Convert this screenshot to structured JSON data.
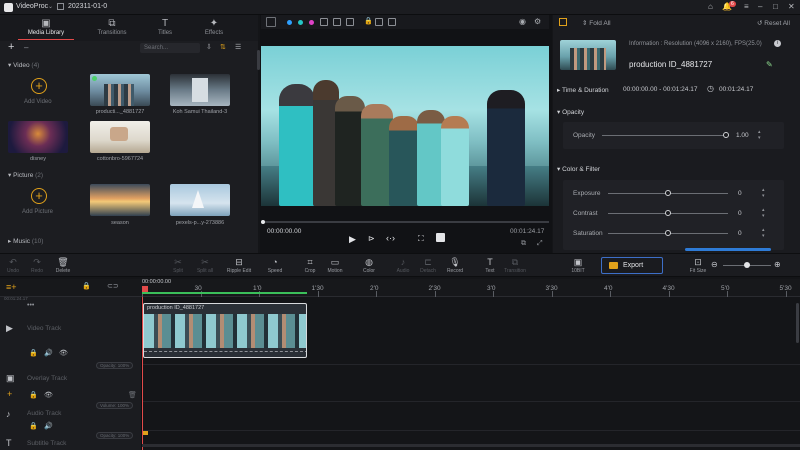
{
  "app": {
    "name": "VideoProc",
    "project": "202311-01-0",
    "notification_count": "6"
  },
  "library": {
    "tabs": [
      {
        "label": "Media Library",
        "icon": "film-icon"
      },
      {
        "label": "Transitions",
        "icon": "transition-icon"
      },
      {
        "label": "Titles",
        "icon": "title-icon"
      },
      {
        "label": "Effects",
        "icon": "effects-icon"
      }
    ],
    "search_placeholder": "Search...",
    "video_section": {
      "title": "Video",
      "count": "(4)"
    },
    "video_items": [
      {
        "label": "Add Video"
      },
      {
        "label": "producti..._4881727"
      },
      {
        "label": "Koh Samui Thailand-3"
      },
      {
        "label": "disney"
      },
      {
        "label": "cottonbro-5967724"
      }
    ],
    "picture_section": {
      "title": "Picture",
      "count": "(2)"
    },
    "picture_items": [
      {
        "label": "Add Picture"
      },
      {
        "label": "season"
      },
      {
        "label": "pexels-p...y-273886"
      }
    ],
    "music_section": {
      "title": "Music",
      "count": "(10)"
    }
  },
  "player": {
    "current_time": "00:00:00.00",
    "total_time": "00:01:24.17",
    "progress": 0.0
  },
  "inspector": {
    "fold_all": "Fold All",
    "reset_all": "Reset All",
    "info": "Information : Resolution (4096 x 2160), FPS(25.0)",
    "clip_name": "production ID_4881727",
    "time_section": "Time & Duration",
    "start": "00:00:00.00 - 00:01:24.17",
    "duration": "00:01:24.17",
    "opacity_section": "Opacity",
    "opacity_label": "Opacity",
    "opacity_value": "1.00",
    "opacity_level": 1.0,
    "color_section": "Color & Filter",
    "exposure_label": "Exposure",
    "exposure_value": "0",
    "contrast_label": "Contrast",
    "contrast_value": "0",
    "saturation_label": "Saturation",
    "saturation_value": "0"
  },
  "toolbar": {
    "undo": "Undo",
    "redo": "Redo",
    "delete": "Delete",
    "split": "Split",
    "split_all": "Split all",
    "ripple_edit": "Ripple Edit",
    "speed": "Speed",
    "crop": "Crop",
    "motion": "Motion",
    "color": "Color",
    "audio": "Audio",
    "detach": "Detach",
    "record": "Record",
    "text": "Text",
    "transition": "Transition",
    "10bit": "10BIT",
    "export": "Export",
    "fit_size": "Fit Size"
  },
  "timeline": {
    "playhead_time": "00:00:00.00",
    "ruler": [
      "0",
      "30",
      "1'0",
      "1'30",
      "2'0",
      "2'30",
      "3'0",
      "3'30",
      "4'0",
      "4'30",
      "5'0",
      "5'30"
    ],
    "duration_label": "00:01:24.17",
    "tracks": [
      {
        "name": "Video Track",
        "pill": "Opacity: 100%"
      },
      {
        "name": "Overlay Track",
        "pill": "Volume: 100%"
      },
      {
        "name": "Audio Track",
        "pill": "Opacity: 100%"
      },
      {
        "name": "Subtitle Track",
        "pill": ""
      }
    ],
    "clip_label": "production ID_4881727"
  }
}
